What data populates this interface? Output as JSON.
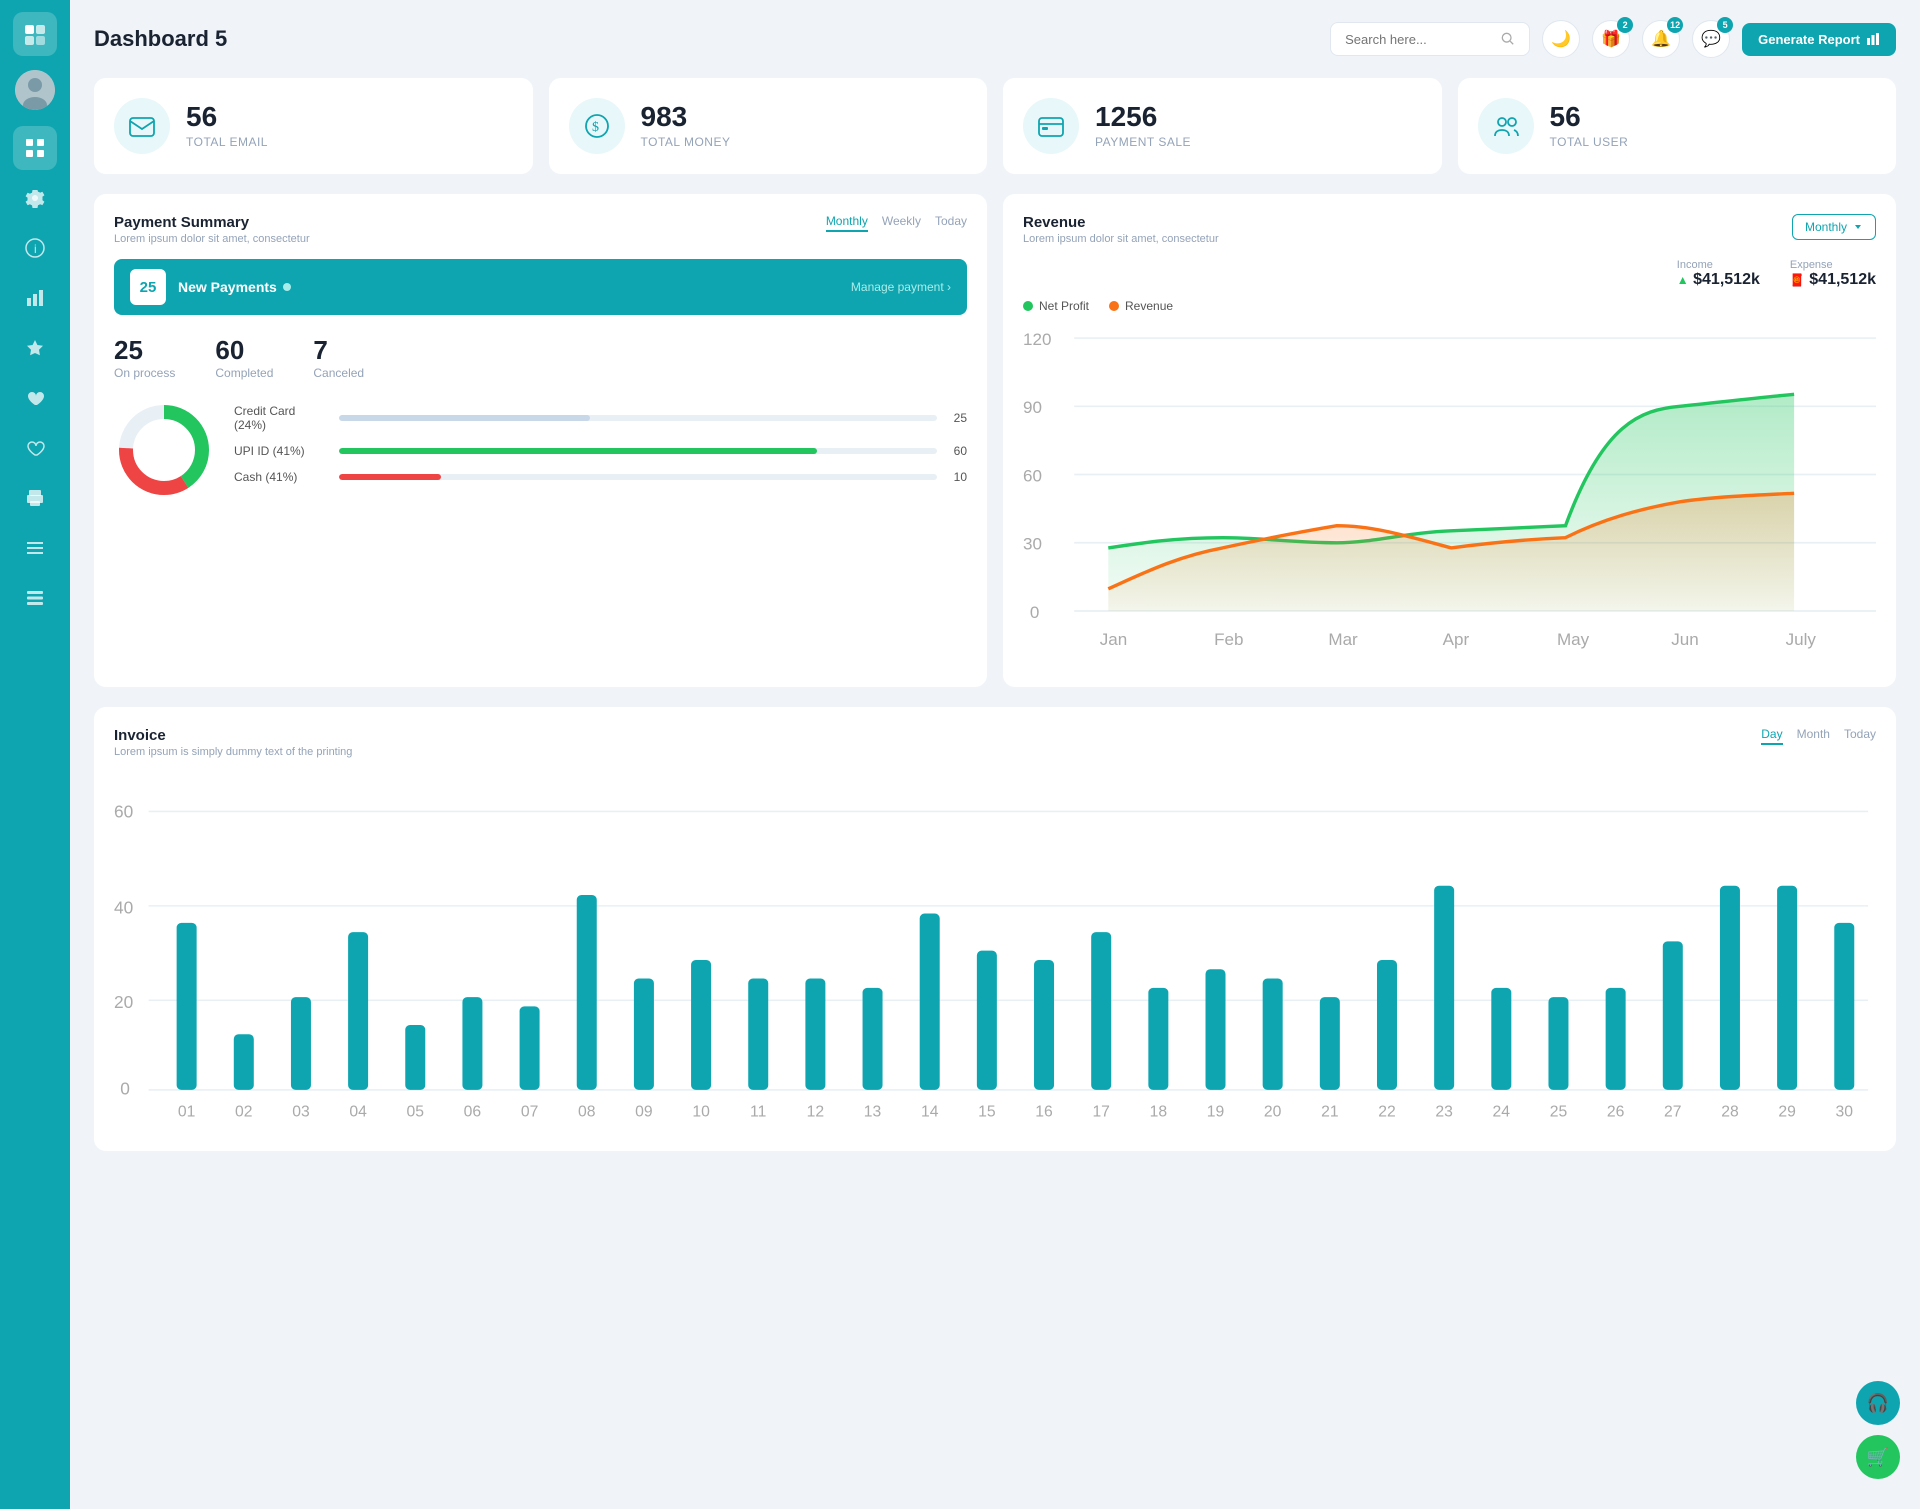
{
  "sidebar": {
    "logo_icon": "💼",
    "items": [
      {
        "id": "home",
        "icon": "⊞",
        "active": true
      },
      {
        "id": "settings",
        "icon": "⚙"
      },
      {
        "id": "info",
        "icon": "ℹ"
      },
      {
        "id": "chart",
        "icon": "📊"
      },
      {
        "id": "star",
        "icon": "★"
      },
      {
        "id": "heart-solid",
        "icon": "♥"
      },
      {
        "id": "heart-outline",
        "icon": "♡"
      },
      {
        "id": "print",
        "icon": "🖨"
      },
      {
        "id": "menu",
        "icon": "☰"
      },
      {
        "id": "list",
        "icon": "📋"
      }
    ]
  },
  "header": {
    "title": "Dashboard 5",
    "search_placeholder": "Search here...",
    "badge_gift": "2",
    "badge_bell": "12",
    "badge_chat": "5",
    "generate_btn": "Generate Report"
  },
  "stats": [
    {
      "id": "email",
      "icon": "📧",
      "number": "56",
      "label": "TOTAL EMAIL"
    },
    {
      "id": "money",
      "icon": "$",
      "number": "983",
      "label": "TOTAL MONEY"
    },
    {
      "id": "payment",
      "icon": "💳",
      "number": "1256",
      "label": "PAYMENT SALE"
    },
    {
      "id": "user",
      "icon": "👥",
      "number": "56",
      "label": "TOTAL USER"
    }
  ],
  "payment_summary": {
    "title": "Payment Summary",
    "subtitle": "Lorem ipsum dolor sit amet, consectetur",
    "tabs": [
      "Monthly",
      "Weekly",
      "Today"
    ],
    "active_tab": "Monthly",
    "new_payments_count": "25",
    "new_payments_label": "New Payments",
    "manage_link": "Manage payment",
    "on_process": "25",
    "on_process_label": "On process",
    "completed": "60",
    "completed_label": "Completed",
    "canceled": "7",
    "canceled_label": "Canceled",
    "progress_items": [
      {
        "label": "Credit Card (24%)",
        "value": 25,
        "max": 60,
        "color": "#c8d8e8",
        "display": "25"
      },
      {
        "label": "UPI ID (41%)",
        "value": 60,
        "max": 60,
        "color": "#22c55e",
        "display": "60"
      },
      {
        "label": "Cash (41%)",
        "value": 10,
        "max": 60,
        "color": "#ef4444",
        "display": "10"
      }
    ],
    "donut": {
      "segments": [
        {
          "value": 24,
          "color": "#e8f0f5"
        },
        {
          "value": 41,
          "color": "#22c55e"
        },
        {
          "value": 35,
          "color": "#ef4444"
        }
      ]
    }
  },
  "revenue": {
    "title": "Revenue",
    "subtitle": "Lorem ipsum dolor sit amet, consectetur",
    "monthly_btn": "Monthly",
    "income_label": "Income",
    "income_value": "$41,512k",
    "expense_label": "Expense",
    "expense_value": "$41,512k",
    "legend": [
      {
        "label": "Net Profit",
        "color": "#22c55e"
      },
      {
        "label": "Revenue",
        "color": "#f97316"
      }
    ],
    "chart": {
      "months": [
        "Jan",
        "Feb",
        "Mar",
        "Apr",
        "May",
        "Jun",
        "July"
      ],
      "net_profit": [
        28,
        32,
        30,
        35,
        38,
        90,
        95
      ],
      "revenue": [
        10,
        28,
        38,
        28,
        32,
        48,
        52
      ]
    }
  },
  "invoice": {
    "title": "Invoice",
    "subtitle": "Lorem ipsum is simply dummy text of the printing",
    "tabs": [
      "Day",
      "Month",
      "Today"
    ],
    "active_tab": "Day",
    "y_labels": [
      "60",
      "40",
      "20",
      "0"
    ],
    "x_labels": [
      "01",
      "02",
      "03",
      "04",
      "05",
      "06",
      "07",
      "08",
      "09",
      "10",
      "11",
      "12",
      "13",
      "14",
      "15",
      "16",
      "17",
      "18",
      "19",
      "20",
      "21",
      "22",
      "23",
      "24",
      "25",
      "26",
      "27",
      "28",
      "29",
      "30"
    ],
    "bar_data": [
      36,
      12,
      20,
      34,
      14,
      20,
      18,
      42,
      24,
      28,
      24,
      24,
      22,
      38,
      30,
      28,
      34,
      22,
      26,
      24,
      20,
      28,
      44,
      22,
      20,
      22,
      32,
      44,
      44,
      36
    ],
    "bar_color": "#0ea5b0"
  },
  "floating": {
    "support_icon": "🎧",
    "cart_icon": "🛒"
  }
}
